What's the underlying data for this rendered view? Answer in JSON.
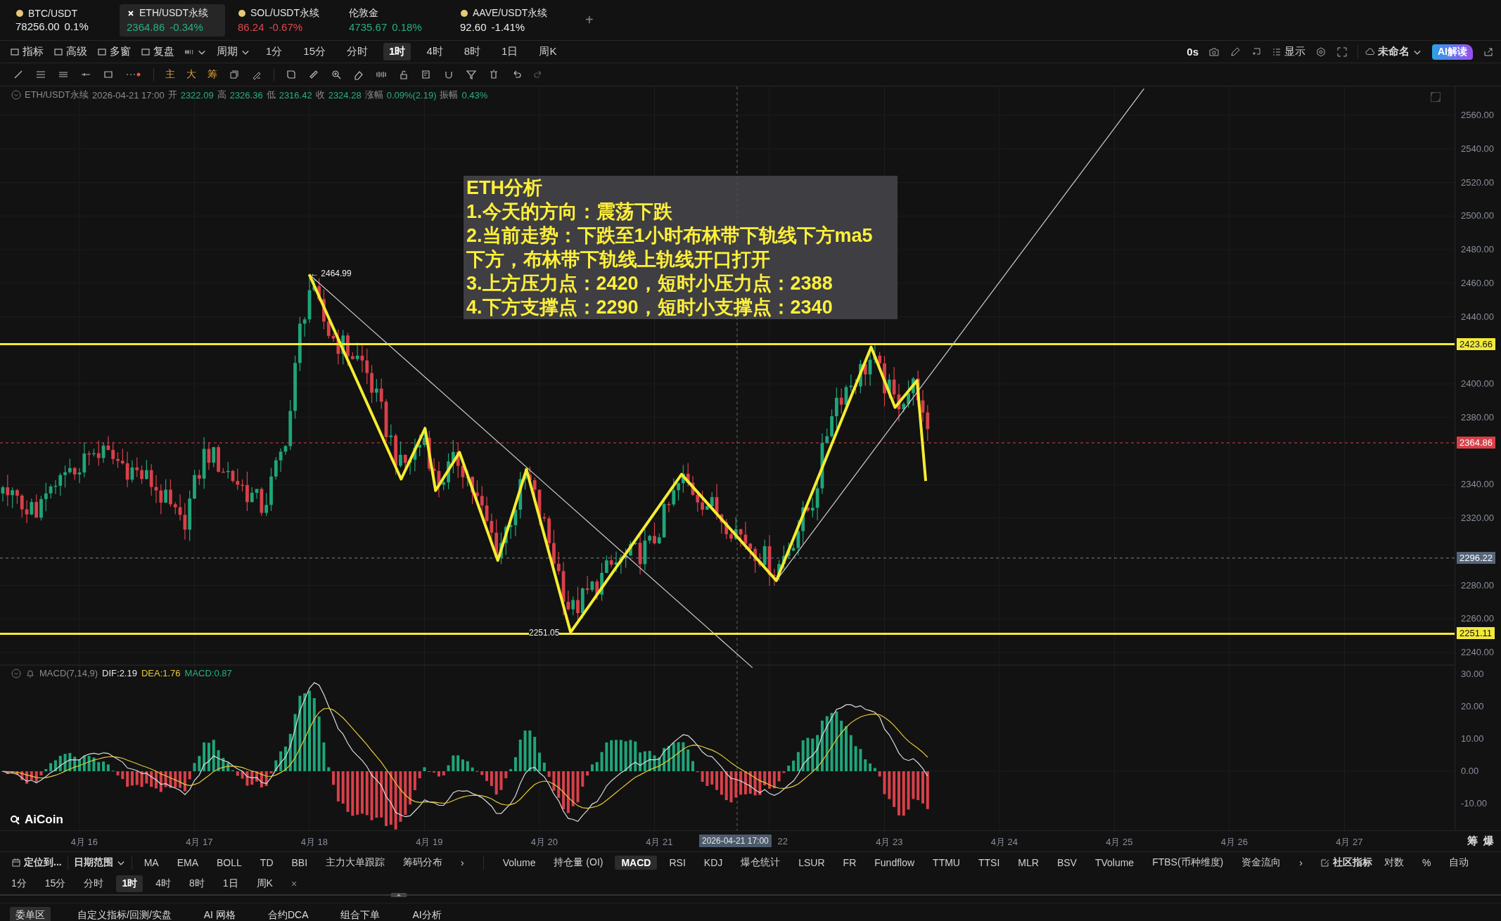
{
  "tickers": [
    {
      "symbol": "BTC/USDT",
      "price": "78256.00",
      "change": "0.1%",
      "color": "#ececec",
      "icon": true,
      "selected": false
    },
    {
      "symbol": "ETH/USDT永续",
      "price": "2364.86",
      "change": "-0.34%",
      "color": "#25b17e",
      "icon": true,
      "selected": true
    },
    {
      "symbol": "SOL/USDT永续",
      "price": "86.24",
      "change": "-0.67%",
      "color": "#e0474f",
      "icon": true,
      "selected": false
    },
    {
      "symbol": "伦敦金",
      "price": "4735.67",
      "change": "0.18%",
      "color": "#25b17e",
      "icon": false,
      "selected": false
    },
    {
      "symbol": "AAVE/USDT永续",
      "price": "92.60",
      "change": "-1.41%",
      "color": "#ececec",
      "icon": true,
      "selected": false
    }
  ],
  "add_tab": "+",
  "toolbar": {
    "tools": [
      "指标",
      "高级",
      "多窗",
      "复盘"
    ],
    "period": "周期",
    "intervals": [
      {
        "label": "1分",
        "selected": false
      },
      {
        "label": "15分",
        "selected": false
      },
      {
        "label": "分时",
        "selected": false
      },
      {
        "label": "1时",
        "selected": true
      },
      {
        "label": "4时",
        "selected": false
      },
      {
        "label": "8时",
        "selected": false
      },
      {
        "label": "1日",
        "selected": false
      },
      {
        "label": "周K",
        "selected": false
      }
    ],
    "countdown": "0s",
    "display": "显示",
    "layout": "未命名",
    "ai_button": "AI解读"
  },
  "shortcuts": [
    "主",
    "大",
    "筹"
  ],
  "info_line": {
    "symbol": "ETH/USDT永续",
    "time": "2026-04-21 17:00",
    "fields": [
      {
        "label": "开",
        "value": "2322.09"
      },
      {
        "label": "高",
        "value": "2326.36"
      },
      {
        "label": "低",
        "value": "2316.42"
      },
      {
        "label": "收",
        "value": "2324.28"
      },
      {
        "label": "涨幅",
        "value": "0.09%(2.19)"
      },
      {
        "label": "振幅",
        "value": "0.43%"
      }
    ]
  },
  "chart": {
    "price_labels": [
      "2560.00",
      "2540.00",
      "2520.00",
      "2500.00",
      "2480.00",
      "2460.00",
      "2440.00",
      "2400.00",
      "2380.00",
      "2340.00",
      "2320.00",
      "2280.00",
      "2260.00",
      "2240.00"
    ],
    "price_tags": [
      {
        "value": "2423.66",
        "kind": "drawing"
      },
      {
        "value": "2364.86",
        "kind": "current"
      },
      {
        "value": "2296.22",
        "kind": "crosshair"
      },
      {
        "value": "2251.11",
        "kind": "drawing"
      }
    ],
    "high_label": "← 2464.99",
    "low_label": "2251.05",
    "date_labels": [
      "4月 16",
      "4月 17",
      "4月 18",
      "4月 19",
      "4月 20",
      "4月 21",
      "22",
      "4月 23",
      "4月 24",
      "4月 25",
      "4月 26",
      "4月 27"
    ],
    "crosshair_date": "2026-04-21 17:00",
    "axis_corner": [
      "筹",
      "爆"
    ],
    "analysis": [
      "ETH分析",
      "1.今天的方向：震荡下跌",
      "2.当前走势：下跌至1小时布林带下轨线下方ma5下方，布林带下轨线上轨线开口打开",
      "3.上方压力点：2420，短时小压力点：2388",
      "4.下方支撑点：2290，短时小支撑点：2340"
    ]
  },
  "macd": {
    "title": "MACD(7,14,9)",
    "dif": "DIF:2.19",
    "dea": "DEA:1.76",
    "macd": "MACD:0.87",
    "axis_labels": [
      "30.00",
      "20.00",
      "10.00",
      "0.00",
      "-10.00"
    ]
  },
  "logo": "AiCoin",
  "indicator_bar": {
    "locate": "定位到...",
    "date_range": "日期范围",
    "main": [
      "MA",
      "EMA",
      "BOLL",
      "TD",
      "BBI",
      "主力大单跟踪",
      "筹码分布"
    ],
    "more": "›",
    "sub": [
      {
        "label": "Volume",
        "selected": false
      },
      {
        "label": "持仓量 (OI)",
        "selected": false
      },
      {
        "label": "MACD",
        "selected": true
      },
      {
        "label": "RSI",
        "selected": false
      },
      {
        "label": "KDJ",
        "selected": false
      },
      {
        "label": "爆仓统计",
        "selected": false
      },
      {
        "label": "LSUR",
        "selected": false
      },
      {
        "label": "FR",
        "selected": false
      },
      {
        "label": "Fundflow",
        "selected": false
      },
      {
        "label": "TTMU",
        "selected": false
      },
      {
        "label": "TTSI",
        "selected": false
      },
      {
        "label": "MLR",
        "selected": false
      },
      {
        "label": "BSV",
        "selected": false
      },
      {
        "label": "TVolume",
        "selected": false
      },
      {
        "label": "FTBS(币种维度)",
        "selected": false
      },
      {
        "label": "资金流向",
        "selected": false
      }
    ],
    "sub_more": "›",
    "community": "社区指标",
    "options": [
      "对数",
      "%",
      "自动"
    ]
  },
  "interval_bar": {
    "items": [
      {
        "label": "1分",
        "selected": false
      },
      {
        "label": "15分",
        "selected": false
      },
      {
        "label": "分时",
        "selected": false
      },
      {
        "label": "1时",
        "selected": true
      },
      {
        "label": "4时",
        "selected": false
      },
      {
        "label": "8时",
        "selected": false
      },
      {
        "label": "1日",
        "selected": false
      },
      {
        "label": "周K",
        "selected": false
      }
    ],
    "close": "×"
  },
  "footer_tabs": [
    {
      "label": "委单区",
      "selected": true
    },
    {
      "label": "自定义指标/回测/实盘",
      "selected": false
    },
    {
      "label": "AI 网格",
      "selected": false
    },
    {
      "label": "合约DCA",
      "selected": false
    },
    {
      "label": "组合下单",
      "selected": false
    },
    {
      "label": "AI分析",
      "selected": false
    }
  ]
}
